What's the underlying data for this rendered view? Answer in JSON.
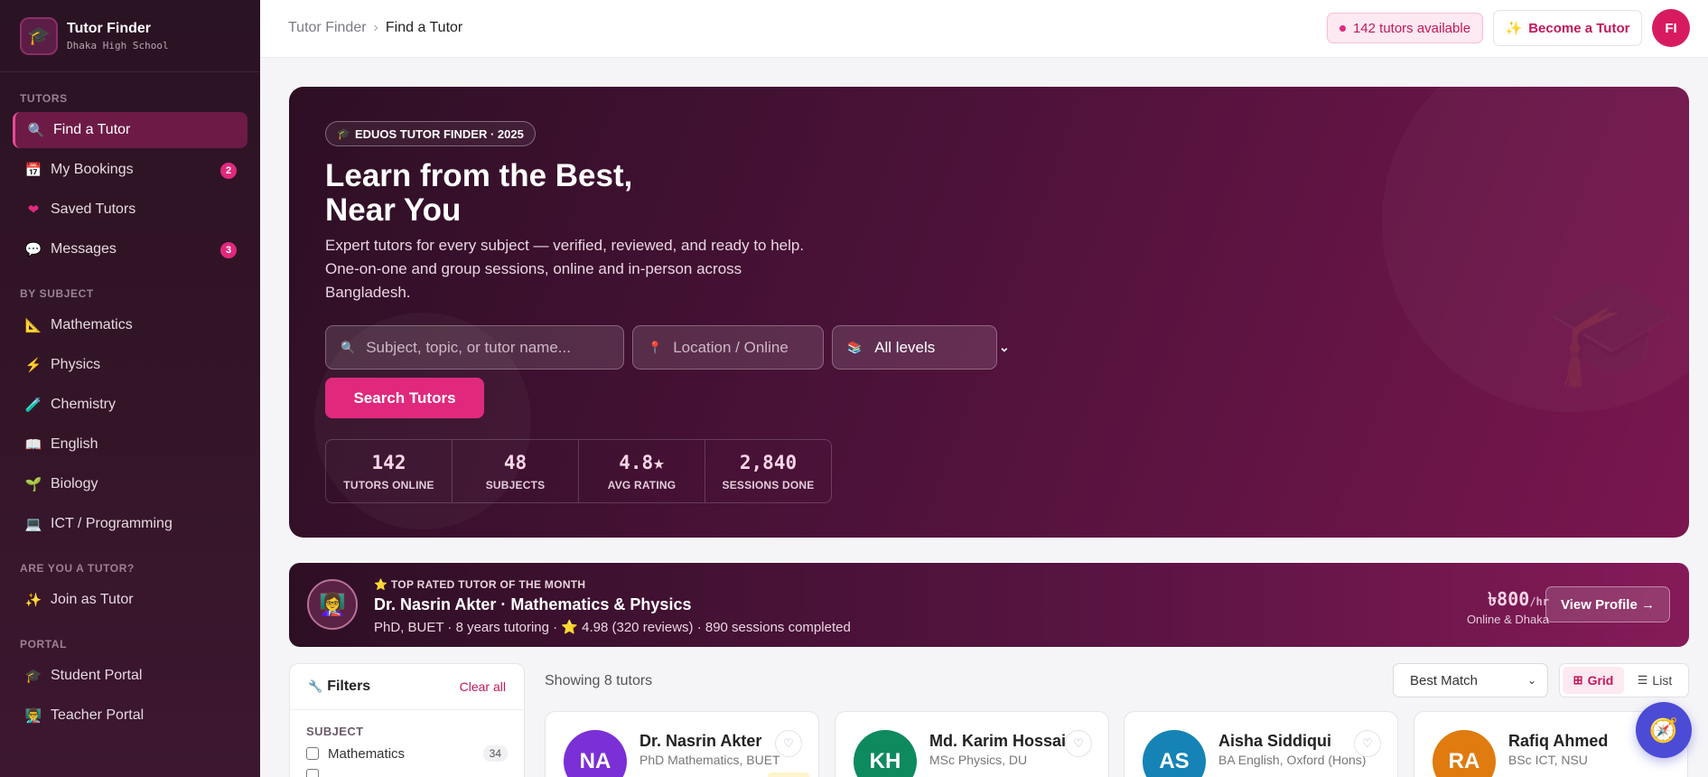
{
  "brand": {
    "title": "Tutor Finder",
    "subtitle": "Dhaka High School",
    "logo_icon": "🎓"
  },
  "sidebar": {
    "sections": [
      {
        "label": "TUTORS",
        "items": [
          {
            "label": "Find a Tutor",
            "icon": "🔍",
            "icon_name": "search-icon",
            "active": true
          },
          {
            "label": "My Bookings",
            "icon": "📅",
            "icon_name": "calendar-icon",
            "badge": "2"
          },
          {
            "label": "Saved Tutors",
            "icon": "❤",
            "icon_name": "heart-icon"
          },
          {
            "label": "Messages",
            "icon": "💬",
            "icon_name": "chat-icon",
            "badge": "3"
          }
        ]
      },
      {
        "label": "BY SUBJECT",
        "items": [
          {
            "label": "Mathematics",
            "icon": "📐",
            "icon_name": "ruler-icon"
          },
          {
            "label": "Physics",
            "icon": "⚡",
            "icon_name": "lightning-icon"
          },
          {
            "label": "Chemistry",
            "icon": "🧪",
            "icon_name": "flask-icon"
          },
          {
            "label": "English",
            "icon": "📖",
            "icon_name": "book-icon"
          },
          {
            "label": "Biology",
            "icon": "🌱",
            "icon_name": "sprout-icon"
          },
          {
            "label": "ICT / Programming",
            "icon": "💻",
            "icon_name": "laptop-icon"
          }
        ]
      },
      {
        "label": "ARE YOU A TUTOR?",
        "items": [
          {
            "label": "Join as Tutor",
            "icon": "✨",
            "icon_name": "sparkles-icon"
          }
        ]
      },
      {
        "label": "PORTAL",
        "items": [
          {
            "label": "Student Portal",
            "icon": "🎓",
            "icon_name": "graduation-cap-icon"
          },
          {
            "label": "Teacher Portal",
            "icon": "👨‍🏫",
            "icon_name": "teacher-icon"
          }
        ]
      }
    ]
  },
  "topbar": {
    "breadcrumb": {
      "root": "Tutor Finder",
      "separator": "›",
      "current": "Find a Tutor"
    },
    "availability": "142 tutors available",
    "become_tutor": "Become a Tutor",
    "become_tutor_icon": "✨",
    "avatar_initials": "FI"
  },
  "hero": {
    "tag_icon": "🎓",
    "tag": "EDUOS TUTOR FINDER · 2025",
    "title": "Learn from the Best, Near You",
    "subtitle": "Expert tutors for every subject — verified, reviewed, and ready to help. One-on-one and group sessions, online and in-person across Bangladesh.",
    "search_placeholder": "Subject, topic, or tutor name...",
    "location_placeholder": "Location / Online",
    "level_value": "All levels",
    "search_button": "Search Tutors",
    "stats": [
      {
        "value": "142",
        "label": "TUTORS ONLINE"
      },
      {
        "value": "48",
        "label": "SUBJECTS"
      },
      {
        "value": "4.8★",
        "label": "AVG RATING"
      },
      {
        "value": "2,840",
        "label": "SESSIONS DONE"
      }
    ]
  },
  "featured": {
    "avatar_icon": "👩‍🏫",
    "label": "TOP RATED TUTOR OF THE MONTH",
    "label_icon": "⭐",
    "name": "Dr. Nasrin Akter · Mathematics & Physics",
    "meta": "PhD, BUET · 8 years tutoring · ⭐ 4.98 (320 reviews) · 890 sessions completed",
    "price": "৳800",
    "price_unit": "/hr",
    "location": "Online & Dhaka",
    "button": "View Profile →"
  },
  "filters": {
    "title": "Filters",
    "clear": "Clear all",
    "subject_label": "SUBJECT",
    "options": [
      {
        "label": "Mathematics",
        "count": "34"
      }
    ]
  },
  "results": {
    "showing": "Showing 8 tutors",
    "sort_value": "Best Match",
    "view_grid": "Grid",
    "view_list": "List"
  },
  "tutors": [
    {
      "initials": "NA",
      "name": "Dr. Nasrin Akter",
      "qualification": "PhD Mathematics, BUET",
      "color": "#7b2fd6"
    },
    {
      "initials": "KH",
      "name": "Md. Karim Hossain",
      "qualification": "MSc Physics, DU",
      "color": "#0e8a5f"
    },
    {
      "initials": "AS",
      "name": "Aisha Siddiqui",
      "qualification": "BA English, Oxford (Hons)",
      "color": "#1583b5"
    },
    {
      "initials": "RA",
      "name": "Rafiq Ahmed",
      "qualification": "BSc ICT, NSU",
      "color": "#e07b0f"
    }
  ],
  "colors": {
    "accent": "#e0297d",
    "sidebar_bg": "#2a1323",
    "hero_start": "#2d0f24",
    "hero_end": "#7a1650"
  }
}
